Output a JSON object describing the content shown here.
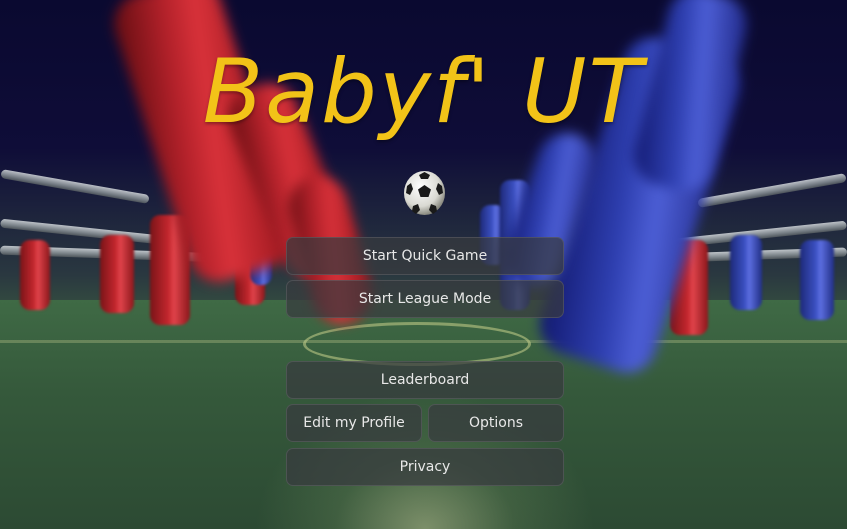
{
  "game": {
    "title": "Babyf' UT"
  },
  "menu": {
    "start_quick_game": "Start Quick Game",
    "start_league_mode": "Start League Mode",
    "leaderboard": "Leaderboard",
    "edit_profile": "Edit my Profile",
    "options": "Options",
    "privacy": "Privacy"
  },
  "colors": {
    "title": "#f2c318",
    "button_bg": "#373a3e",
    "button_text": "#e8e8e8",
    "team_red": "#c2262d",
    "team_blue": "#3a4fc0"
  },
  "icons": {
    "ball": "soccer-ball-icon"
  }
}
